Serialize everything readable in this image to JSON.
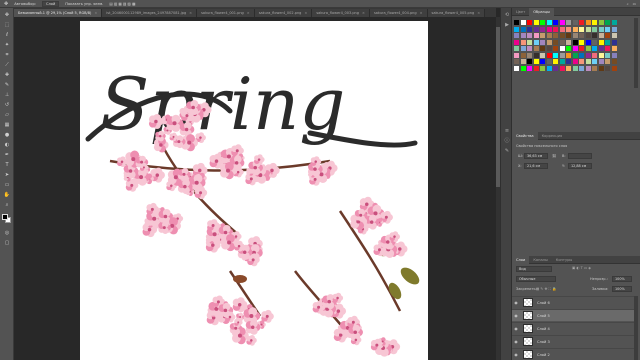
{
  "options_bar": {
    "tool_icon": "move-tool-icon",
    "autoselect_label": "Автовыбор:",
    "autoselect_value": "Слой",
    "show_transform_label": "Показать упр. элем."
  },
  "tabs": [
    {
      "label": "Безымянный-1 @ 29,1% (Слой 5, RGB/8)",
      "active": true
    },
    {
      "label": "ist_2046000112989_images_2497887081.jpg",
      "active": false
    },
    {
      "label": "sakura_flower4_001.png",
      "active": false
    },
    {
      "label": "sakura_flower4_002.png",
      "active": false
    },
    {
      "label": "sakura_flower4_003.png",
      "active": false
    },
    {
      "label": "sakura_flower4_004.png",
      "active": false
    },
    {
      "label": "sakura_flower4_005.png",
      "active": false
    }
  ],
  "document": {
    "title_text": "Spring",
    "colors": {
      "text": "#2b2b2b",
      "petal_light": "#f7c6d4",
      "petal_mid": "#ee8fb1",
      "petal_dark": "#c94f7d",
      "branch": "#6b3a2a"
    }
  },
  "panels": {
    "swatches_tabs": [
      "Цвет",
      "Образцы"
    ],
    "swatch_colors": [
      "#000000",
      "#ffffff",
      "#ff0000",
      "#ffff00",
      "#00ff00",
      "#00ffff",
      "#0000ff",
      "#ff00ff",
      "#9c9c9c",
      "#636363",
      "#ed1c24",
      "#f7941d",
      "#fff200",
      "#8dc63f",
      "#00a651",
      "#00a99d",
      "#00aeef",
      "#0072bc",
      "#2e3192",
      "#662d91",
      "#92278f",
      "#ec008c",
      "#ed145b",
      "#f26d7d",
      "#f69679",
      "#fbaf5d",
      "#fff799",
      "#c4df9b",
      "#82ca9c",
      "#7accc8",
      "#6dcff6",
      "#7da7d9",
      "#8781bd",
      "#a186be",
      "#bd8cbf",
      "#f49ac1",
      "#c69c6d",
      "#a67c52",
      "#8c6239",
      "#754c24",
      "#603913",
      "#998675",
      "#736357",
      "#534741",
      "#362f2d",
      "#c7b299",
      "#a0410d",
      "#ccc6b0"
    ],
    "properties_tabs": [
      "Свойства",
      "Коррекция"
    ],
    "properties_heading": "Свойства пиксельного слоя",
    "w_label": "Ш:",
    "w_value": "36,63 см",
    "h_label": "В:",
    "h_value": "",
    "x_label": "X:",
    "x_value": "21,6 см",
    "y_label": "Y:",
    "y_value": "12,88 см",
    "layers_tabs": [
      "Слои",
      "Каналы",
      "Контуры"
    ],
    "layer_kind_label": "Вид",
    "blend_mode": "Обычные",
    "opacity_label": "Непрозр.:",
    "opacity_value": "100%",
    "lock_label": "Закрепить:",
    "fill_label": "Заливка:",
    "fill_value": "100%",
    "layers": [
      {
        "name": "Слой 6",
        "selected": false
      },
      {
        "name": "Слой 5",
        "selected": true
      },
      {
        "name": "Слой 4",
        "selected": false
      },
      {
        "name": "Слой 3",
        "selected": false
      },
      {
        "name": "Слой 2",
        "selected": false
      }
    ]
  },
  "toolbar_icons": [
    "move-tool-icon",
    "marquee-tool-icon",
    "lasso-tool-icon",
    "magic-wand-icon",
    "crop-tool-icon",
    "eyedropper-icon",
    "healing-brush-icon",
    "brush-tool-icon",
    "clone-stamp-icon",
    "history-brush-icon",
    "eraser-tool-icon",
    "gradient-tool-icon",
    "blur-tool-icon",
    "dodge-tool-icon",
    "pen-tool-icon",
    "type-tool-icon",
    "path-select-icon",
    "shape-tool-icon",
    "hand-tool-icon",
    "zoom-tool-icon"
  ]
}
